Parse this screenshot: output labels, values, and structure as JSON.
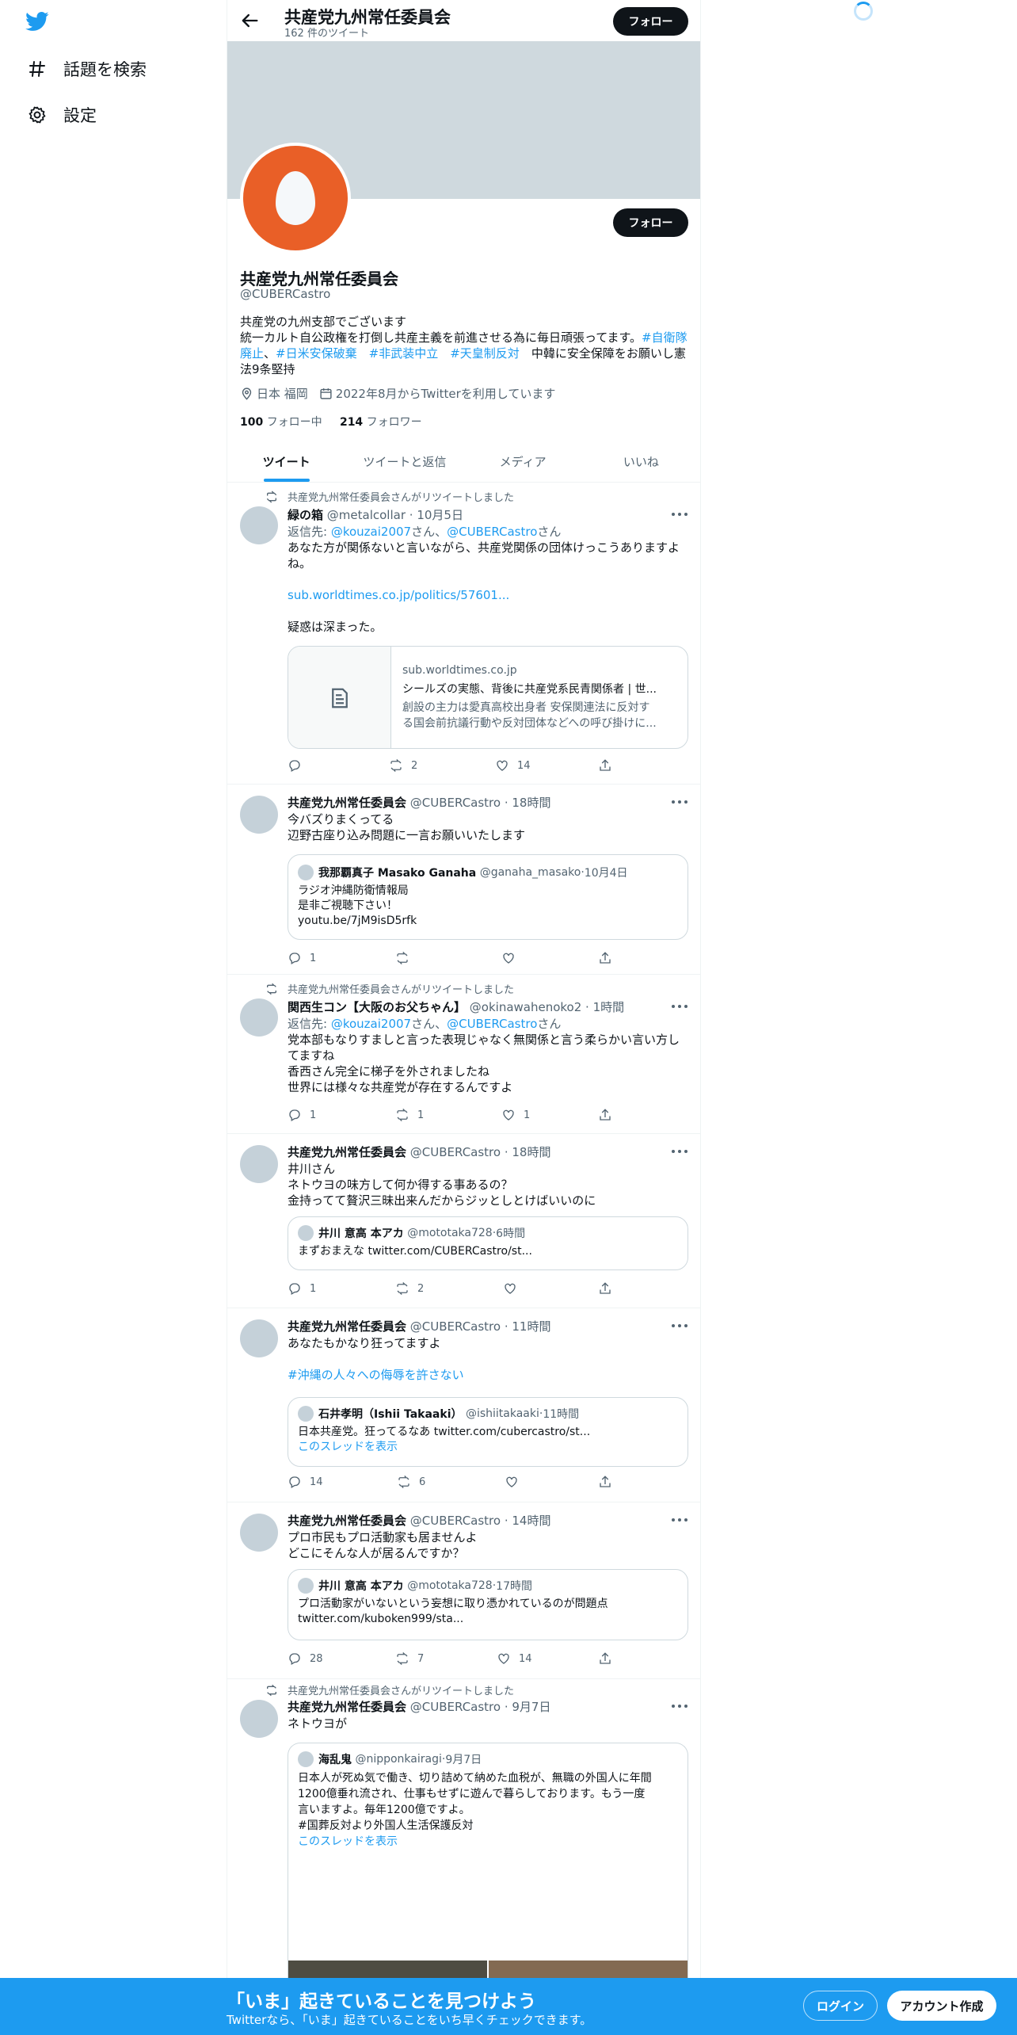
{
  "nav": {
    "explore_label": "話題を検索",
    "settings_label": "設定"
  },
  "header": {
    "name": "共産党九州常任委員会",
    "tweet_count": "162 件のツイート",
    "follow_label": "フォロー"
  },
  "profile": {
    "name": "共産党九州常任委員会",
    "handle": "@CUBERCastro",
    "follow_label": "フォロー",
    "bio_line1": "共産党の九州支部でございます",
    "bio_line2_text": "統一カルト自公政権を打倒し共産主義を前進させる為に毎日頑張ってます。",
    "bio_line2_tag": "#自衛隊",
    "bio_line3_tag1": "廃止",
    "bio_line3_tag2": "#日米安保破棄",
    "bio_line3_tag3": "#非武装中立",
    "bio_line3_tag4": "#天皇制反対",
    "bio_line3_text": "中韓に安全保障をお願いし憲",
    "bio_line4": "法9条堅持",
    "location": "日本 福岡",
    "joined": "2022年8月からTwitterを利用しています",
    "following_count": "100",
    "following_label": "フォロー中",
    "followers_count": "214",
    "followers_label": "フォロワー"
  },
  "tabs": [
    "ツイート",
    "ツイートと返信",
    "メディア",
    "いいね"
  ],
  "tweets": [
    {
      "retweet_note": "共産党九州常任委員会さんがリツイートしました",
      "name": "緑の箱",
      "handle": "@metalcollar",
      "time": "10月5日",
      "reply_prefix": "返信先: ",
      "reply_to1": "@kouzai2007",
      "reply_mid": "さん、",
      "reply_to2": "@CUBERCastro",
      "reply_suffix": "さん",
      "lines": [
        "あなた方が関係ないと言いながら、共産党関係の団体けっこうありますよ",
        "ね。",
        "",
        "sub.worldtimes.co.jp/politics/57601...",
        "",
        "疑惑は深まった。"
      ],
      "card_domain": "sub.worldtimes.co.jp",
      "card_title": "シールズの実態、背後に共産党系民青関係者 | 世...",
      "card_desc1": "創設の主力は愛真高校出身者 安保関連法に反対す",
      "card_desc2": "る国会前抗議行動や反対団体などへの呼び掛けに...",
      "replies": "",
      "retweets": "2",
      "likes": "14"
    },
    {
      "name": "共産党九州常任委員会",
      "handle": "@CUBERCastro",
      "time": "18時間",
      "lines": [
        "今バズりまくってる",
        "辺野古座り込み問題に一言お願いいたします"
      ],
      "quote_name": "我那覇真子 Masako Ganaha",
      "quote_handle": "@ganaha_masako",
      "quote_time": "10月4日",
      "quote_lines": [
        "ラジオ沖縄防衛情報局",
        "是非ご視聴下さい！",
        "youtu.be/7jM9isD5rfk"
      ],
      "replies": "1",
      "retweets": "",
      "likes": ""
    },
    {
      "retweet_note": "共産党九州常任委員会さんがリツイートしました",
      "name": "関西生コン【大阪のお父ちゃん】",
      "handle": "@okinawahenoko2",
      "time": "1時間",
      "reply_prefix": "返信先: ",
      "reply_to1": "@kouzai2007",
      "reply_mid": "さん、",
      "reply_to2": "@CUBERCastro",
      "reply_suffix": "さん",
      "lines": [
        "党本部もなりすましと言った表現じゃなく無関係と言う柔らかい言い方し",
        "てますね",
        "香西さん完全に梯子を外されましたね",
        "世界には様々な共産党が存在するんですよ"
      ],
      "replies": "1",
      "retweets": "1",
      "likes": "1"
    },
    {
      "name": "共産党九州常任委員会",
      "handle": "@CUBERCastro",
      "time": "18時間",
      "lines": [
        "井川さん",
        "ネトウヨの味方して何か得する事あるの？",
        "金持ってて贅沢三昧出来んだからジッとしとけばいいのに"
      ],
      "quote_name": "井川 意高 本アカ",
      "quote_handle": "@mototaka728",
      "quote_time": "6時間",
      "quote_lines": [
        "まずおまえな twitter.com/CUBERCastro/st..."
      ],
      "replies": "1",
      "retweets": "2",
      "likes": ""
    },
    {
      "name": "共産党九州常任委員会",
      "handle": "@CUBERCastro",
      "time": "11時間",
      "lines": [
        "あなたもかなり狂ってますよ",
        ""
      ],
      "hashtag_line": "#沖縄の人々への侮辱を許さない",
      "quote_name": "石井孝明（Ishii Takaaki）",
      "quote_handle": "@ishiitakaaki",
      "quote_time": "11時間",
      "quote_lines": [
        "日本共産党。狂ってるなあ twitter.com/cubercastro/st..."
      ],
      "quote_thread": "このスレッドを表示",
      "replies": "14",
      "retweets": "6",
      "likes": ""
    },
    {
      "name": "共産党九州常任委員会",
      "handle": "@CUBERCastro",
      "time": "14時間",
      "lines": [
        "プロ市民もプロ活動家も居ませんよ",
        "どこにそんな人が居るんですか？"
      ],
      "quote_name": "井川 意高 本アカ",
      "quote_handle": "@mototaka728",
      "quote_time": "17時間",
      "quote_lines": [
        "プロ活動家がいないという妄想に取り憑かれているのが問題点",
        "twitter.com/kuboken999/sta..."
      ],
      "replies": "28",
      "retweets": "7",
      "likes": "14"
    },
    {
      "retweet_note": "共産党九州常任委員会さんがリツイートしました",
      "name": "共産党九州常任委員会",
      "handle": "@CUBERCastro",
      "time": "9月7日",
      "lines": [
        "ネトウヨが"
      ],
      "quote_name": "海乱鬼",
      "quote_handle": "@nipponkairagi",
      "quote_time": "9月7日",
      "quote_lines": [
        "日本人が死ぬ気で働き、切り詰めて納めた血税が、無職の外国人に年間",
        "1200億垂れ流され、仕事もせずに遊んで暮らしております。もう一度",
        "言いますよ。毎年1200億ですよ。",
        "#国葬反対より外国人生活保護反対"
      ],
      "quote_thread": "このスレッドを表示",
      "image_colors": [
        "#4e4c42",
        "#836a52"
      ]
    }
  ],
  "bottom": {
    "title": "「いま」起きていることを見つけよう",
    "subtitle": "Twitterなら、「いま」起きていることをいち早くチェックできます。",
    "login_label": "ログイン",
    "signup_label": "アカウント作成"
  },
  "colors": {
    "accent": "#1d9bf0",
    "avatar": "#e95f27"
  }
}
